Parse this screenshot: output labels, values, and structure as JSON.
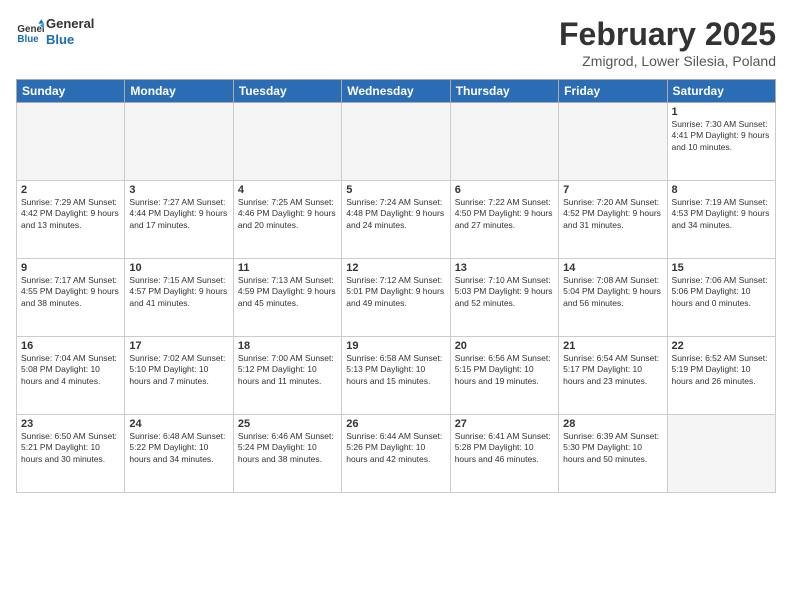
{
  "header": {
    "logo_general": "General",
    "logo_blue": "Blue",
    "month_title": "February 2025",
    "location": "Zmigrod, Lower Silesia, Poland"
  },
  "days_of_week": [
    "Sunday",
    "Monday",
    "Tuesday",
    "Wednesday",
    "Thursday",
    "Friday",
    "Saturday"
  ],
  "weeks": [
    [
      {
        "day": "",
        "info": ""
      },
      {
        "day": "",
        "info": ""
      },
      {
        "day": "",
        "info": ""
      },
      {
        "day": "",
        "info": ""
      },
      {
        "day": "",
        "info": ""
      },
      {
        "day": "",
        "info": ""
      },
      {
        "day": "1",
        "info": "Sunrise: 7:30 AM\nSunset: 4:41 PM\nDaylight: 9 hours\nand 10 minutes."
      }
    ],
    [
      {
        "day": "2",
        "info": "Sunrise: 7:29 AM\nSunset: 4:42 PM\nDaylight: 9 hours\nand 13 minutes."
      },
      {
        "day": "3",
        "info": "Sunrise: 7:27 AM\nSunset: 4:44 PM\nDaylight: 9 hours\nand 17 minutes."
      },
      {
        "day": "4",
        "info": "Sunrise: 7:25 AM\nSunset: 4:46 PM\nDaylight: 9 hours\nand 20 minutes."
      },
      {
        "day": "5",
        "info": "Sunrise: 7:24 AM\nSunset: 4:48 PM\nDaylight: 9 hours\nand 24 minutes."
      },
      {
        "day": "6",
        "info": "Sunrise: 7:22 AM\nSunset: 4:50 PM\nDaylight: 9 hours\nand 27 minutes."
      },
      {
        "day": "7",
        "info": "Sunrise: 7:20 AM\nSunset: 4:52 PM\nDaylight: 9 hours\nand 31 minutes."
      },
      {
        "day": "8",
        "info": "Sunrise: 7:19 AM\nSunset: 4:53 PM\nDaylight: 9 hours\nand 34 minutes."
      }
    ],
    [
      {
        "day": "9",
        "info": "Sunrise: 7:17 AM\nSunset: 4:55 PM\nDaylight: 9 hours\nand 38 minutes."
      },
      {
        "day": "10",
        "info": "Sunrise: 7:15 AM\nSunset: 4:57 PM\nDaylight: 9 hours\nand 41 minutes."
      },
      {
        "day": "11",
        "info": "Sunrise: 7:13 AM\nSunset: 4:59 PM\nDaylight: 9 hours\nand 45 minutes."
      },
      {
        "day": "12",
        "info": "Sunrise: 7:12 AM\nSunset: 5:01 PM\nDaylight: 9 hours\nand 49 minutes."
      },
      {
        "day": "13",
        "info": "Sunrise: 7:10 AM\nSunset: 5:03 PM\nDaylight: 9 hours\nand 52 minutes."
      },
      {
        "day": "14",
        "info": "Sunrise: 7:08 AM\nSunset: 5:04 PM\nDaylight: 9 hours\nand 56 minutes."
      },
      {
        "day": "15",
        "info": "Sunrise: 7:06 AM\nSunset: 5:06 PM\nDaylight: 10 hours\nand 0 minutes."
      }
    ],
    [
      {
        "day": "16",
        "info": "Sunrise: 7:04 AM\nSunset: 5:08 PM\nDaylight: 10 hours\nand 4 minutes."
      },
      {
        "day": "17",
        "info": "Sunrise: 7:02 AM\nSunset: 5:10 PM\nDaylight: 10 hours\nand 7 minutes."
      },
      {
        "day": "18",
        "info": "Sunrise: 7:00 AM\nSunset: 5:12 PM\nDaylight: 10 hours\nand 11 minutes."
      },
      {
        "day": "19",
        "info": "Sunrise: 6:58 AM\nSunset: 5:13 PM\nDaylight: 10 hours\nand 15 minutes."
      },
      {
        "day": "20",
        "info": "Sunrise: 6:56 AM\nSunset: 5:15 PM\nDaylight: 10 hours\nand 19 minutes."
      },
      {
        "day": "21",
        "info": "Sunrise: 6:54 AM\nSunset: 5:17 PM\nDaylight: 10 hours\nand 23 minutes."
      },
      {
        "day": "22",
        "info": "Sunrise: 6:52 AM\nSunset: 5:19 PM\nDaylight: 10 hours\nand 26 minutes."
      }
    ],
    [
      {
        "day": "23",
        "info": "Sunrise: 6:50 AM\nSunset: 5:21 PM\nDaylight: 10 hours\nand 30 minutes."
      },
      {
        "day": "24",
        "info": "Sunrise: 6:48 AM\nSunset: 5:22 PM\nDaylight: 10 hours\nand 34 minutes."
      },
      {
        "day": "25",
        "info": "Sunrise: 6:46 AM\nSunset: 5:24 PM\nDaylight: 10 hours\nand 38 minutes."
      },
      {
        "day": "26",
        "info": "Sunrise: 6:44 AM\nSunset: 5:26 PM\nDaylight: 10 hours\nand 42 minutes."
      },
      {
        "day": "27",
        "info": "Sunrise: 6:41 AM\nSunset: 5:28 PM\nDaylight: 10 hours\nand 46 minutes."
      },
      {
        "day": "28",
        "info": "Sunrise: 6:39 AM\nSunset: 5:30 PM\nDaylight: 10 hours\nand 50 minutes."
      },
      {
        "day": "",
        "info": ""
      }
    ]
  ]
}
